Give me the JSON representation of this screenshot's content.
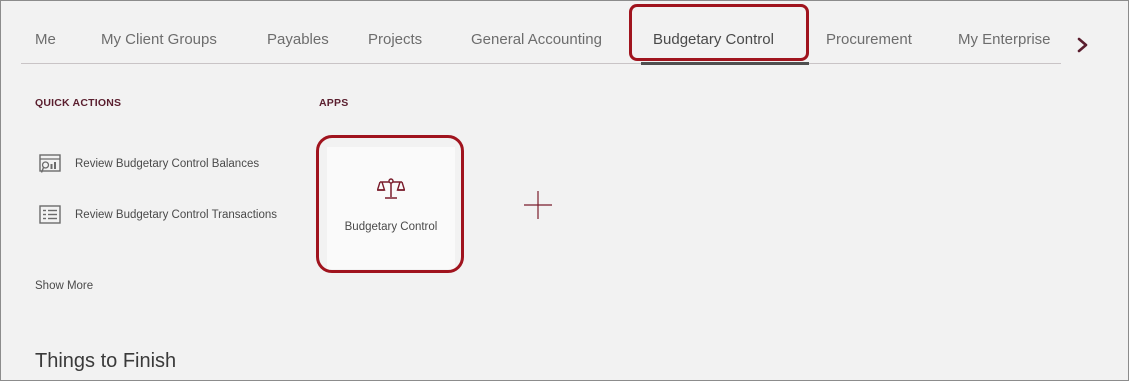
{
  "nav": {
    "tabs": [
      {
        "label": "Me"
      },
      {
        "label": "My Client Groups"
      },
      {
        "label": "Payables"
      },
      {
        "label": "Projects"
      },
      {
        "label": "General Accounting"
      },
      {
        "label": "Budgetary Control",
        "active": true
      },
      {
        "label": "Procurement"
      },
      {
        "label": "My Enterprise"
      }
    ],
    "more_icon": "chevron-right-icon"
  },
  "quick_actions": {
    "heading": "QUICK ACTIONS",
    "items": [
      {
        "label": "Review Budgetary Control Balances",
        "icon": "balances-report-icon"
      },
      {
        "label": "Review Budgetary Control Transactions",
        "icon": "transactions-list-icon"
      }
    ],
    "show_more": "Show More"
  },
  "apps": {
    "heading": "APPS",
    "tiles": [
      {
        "label": "Budgetary Control",
        "icon": "scales-icon"
      }
    ],
    "add_icon": "plus-icon"
  },
  "things_to_finish": {
    "title": "Things to Finish"
  },
  "colors": {
    "accent": "#a0141e",
    "heading": "#5a1e2e",
    "background": "#f2f2f2"
  }
}
